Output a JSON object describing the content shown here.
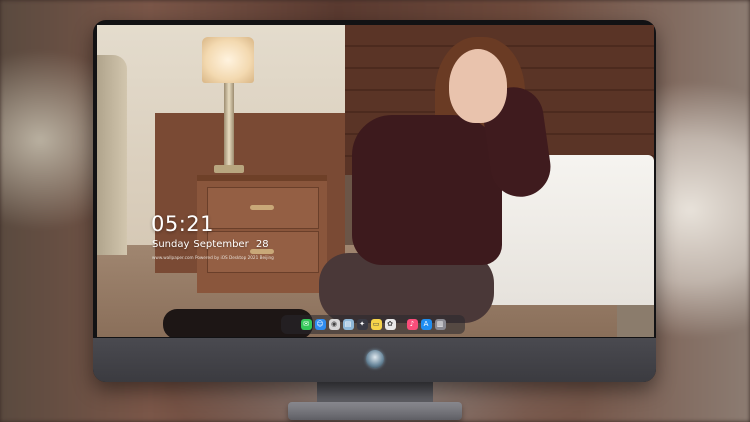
{
  "lock_screen": {
    "time": "05:21",
    "weekday": "Sunday",
    "month": "September",
    "day": "28",
    "info_line": "www.wallpaper.com  Powered by iOS Desktop  2021  Beijing"
  },
  "dock": {
    "items": [
      {
        "name": "messages-icon",
        "color": "#34c759",
        "glyph": "✉"
      },
      {
        "name": "finder-icon",
        "color": "#2f8cf0",
        "glyph": "☺"
      },
      {
        "name": "safari-icon",
        "color": "#d8d8d8",
        "glyph": "◉"
      },
      {
        "name": "preview-icon",
        "color": "#8fb8d8",
        "glyph": "▤"
      },
      {
        "name": "imovie-icon",
        "color": "#3a3a44",
        "glyph": "✦"
      },
      {
        "name": "notes-icon",
        "color": "#f6d44a",
        "glyph": "▭"
      },
      {
        "name": "photos-icon",
        "color": "#e9e9e9",
        "glyph": "✿"
      },
      {
        "name": "music-icon",
        "color": "#fa4d7a",
        "glyph": "♪"
      },
      {
        "name": "app-store-icon",
        "color": "#1f8ef1",
        "glyph": "A"
      },
      {
        "name": "trash-icon",
        "color": "#8a8a92",
        "glyph": "▥"
      }
    ]
  },
  "colors": {
    "monitor_frame": "#121214",
    "chin": "#3b3b40",
    "text": "#ffffff"
  }
}
